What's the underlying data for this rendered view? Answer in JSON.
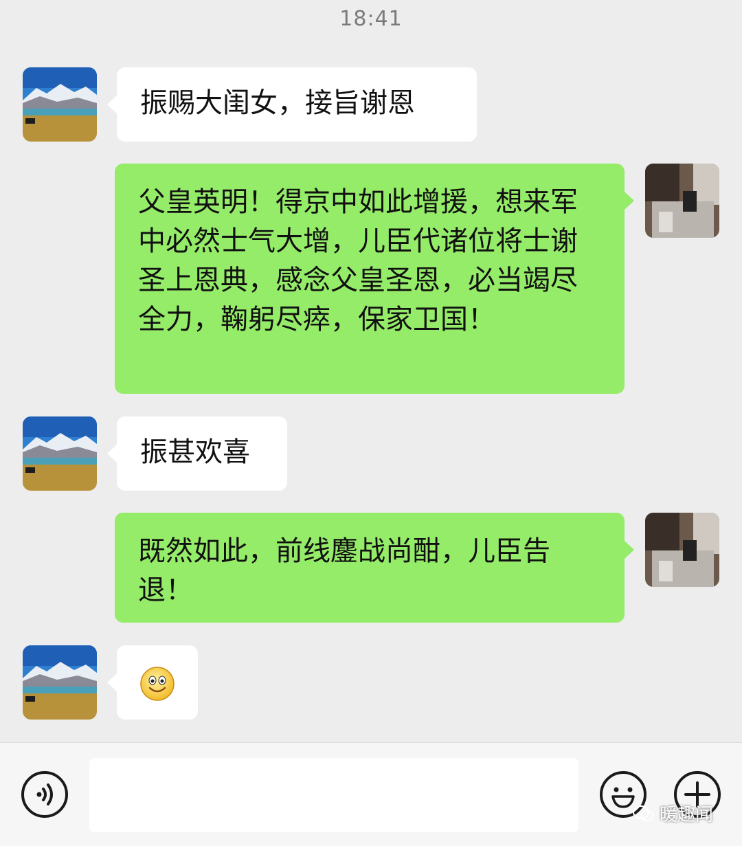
{
  "status": {
    "time": "18:41"
  },
  "contacts": {
    "incoming_avatar": "landscape-avatar-icon",
    "outgoing_avatar": "photo-avatar-icon"
  },
  "messages": [
    {
      "side": "in",
      "text": "振赐大闺女，接旨谢恩"
    },
    {
      "side": "out",
      "text": "父皇英明！得京中如此增援，想来军中必然士气大增，儿臣代诸位将士谢圣上恩典，感念父皇圣恩，必当竭尽全力，鞠躬尽瘁，保家卫国！"
    },
    {
      "side": "in",
      "text": "振甚欢喜"
    },
    {
      "side": "out",
      "text": "既然如此，前线鏖战尚酣，儿臣告退！"
    },
    {
      "side": "in",
      "text": "",
      "icon": "smile-emoji-icon"
    }
  ],
  "input_bar": {
    "voice_icon": "voice-icon",
    "emoji_icon": "emoji-icon",
    "plus_icon": "plus-icon",
    "placeholder": ""
  },
  "watermark": {
    "text": "暖趣闻",
    "icon": "wechat-channel-icon"
  },
  "colors": {
    "background": "#ededed",
    "incoming_bubble": "#ffffff",
    "outgoing_bubble": "#95ec69",
    "text": "#111111"
  }
}
